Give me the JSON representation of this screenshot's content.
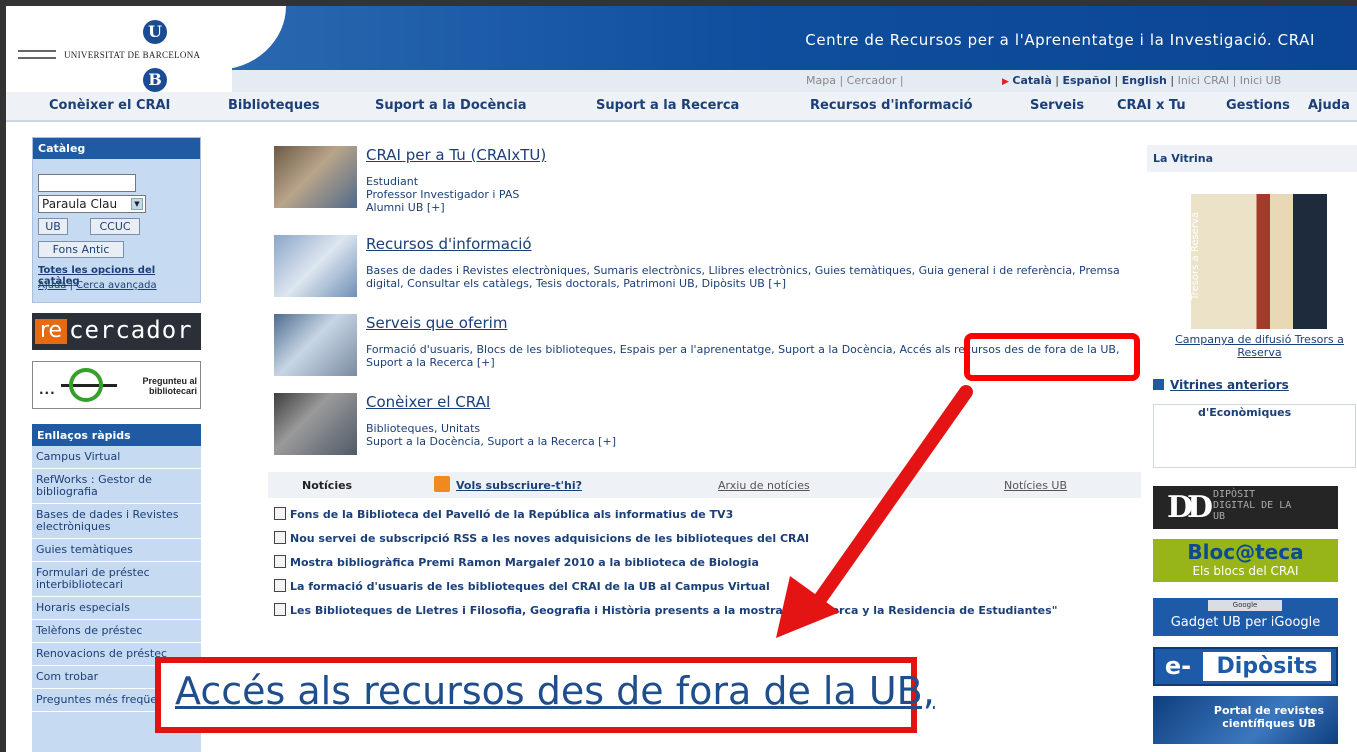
{
  "header": {
    "logo_top": "U",
    "logo_bottom": "B",
    "logo_text": "UNIVERSITAT DE BARCELONA",
    "title": "Centre de Recursos per a l'Aprenentatge i la Investigació. CRAI",
    "util_left": "Mapa | Cercador |",
    "util_langs": [
      "Català",
      "Español",
      "English"
    ],
    "util_right": "Inici CRAI | Inici UB"
  },
  "nav": {
    "items": [
      "Conèixer el CRAI",
      "Biblioteques",
      "Suport a la Docència",
      "Suport a la Recerca",
      "Recursos d'informació",
      "Serveis",
      "CRAI x Tu",
      "Gestions",
      "Ajuda"
    ]
  },
  "catalog": {
    "title": "Catàleg",
    "search_value": "",
    "select_value": "Paraula Clau",
    "btn_ub": "UB",
    "btn_ccuc": "CCUC",
    "btn_fons": "Fons Antic",
    "link_all": "Totes les opcions del catàleg",
    "link_help": "Ajuda",
    "link_adv": "Cerca avançada"
  },
  "recercador": {
    "prefix": "re",
    "text": "cercador"
  },
  "pregunteu": {
    "text": "Pregunteu al bibliotecari"
  },
  "quicklinks": {
    "title": "Enllaços ràpids",
    "items": [
      "Campus Virtual",
      "RefWorks : Gestor de bibliografia",
      "Bases de dades i Revistes electròniques",
      "Guies temàtiques",
      "Formulari de préstec interbibliotecari",
      "Horaris especials",
      "Telèfons de préstec",
      "Renovacions de préstec",
      "Com trobar",
      "Preguntes més freqüents"
    ]
  },
  "sections": [
    {
      "title": "CRAI per a Tu (CRAIxTU)",
      "body": "Estudiant\nProfessor Investigador i PAS\nAlumni UB [+]"
    },
    {
      "title": "Recursos d'informació",
      "body": "Bases de dades i Revistes electròniques, Sumaris electrònics, Llibres electrònics, Guies temàtiques, Guia general i de referència, Premsa digital, Consultar els catàlegs, Tesis doctorals, Patrimoni UB, Dipòsits UB [+]"
    },
    {
      "title": "Serveis que oferim",
      "body": "Formació d'usuaris, Blocs de les biblioteques, Espais per a l'aprenentatge, Suport a la Docència, Accés als recursos des de fora de la UB, Suport a la Recerca [+]"
    },
    {
      "title": "Conèixer el CRAI",
      "body": "Biblioteques, Unitats\nSuport a la Docència, Suport a la Recerca [+]"
    }
  ],
  "news": {
    "label": "Notícies",
    "subscribe": "Vols subscriure-t'hi?",
    "archive": "Arxiu de notícies",
    "ub_news": "Notícies UB",
    "items": [
      "Fons de la Biblioteca del Pavelló de la República als informatius de TV3",
      "Nou servei de subscripció RSS a les noves adquisicions de les biblioteques del CRAI",
      "Mostra bibliogràfica Premi Ramon Margalef 2010 a la biblioteca de Biologia",
      "La formació d'usuaris de les biblioteques del CRAI de la UB al Campus Virtual",
      "Les Biblioteques de Lletres i Filosofia, Geografia i Història presents a la mostra \"Dalí, Lorca y la Residencia de Estudiantes\""
    ]
  },
  "vitrina": {
    "title": "La Vitrina",
    "image_text": "Tresors a Reserva",
    "caption": "Campanya de difusió Tresors a Reserva",
    "previous": "Vitrines anteriors",
    "box_text": "d'Econòmiques"
  },
  "banners": {
    "dipo_logo": "DD",
    "dipo_text": "DIPÒSIT DIGITAL DE LA UB",
    "bloc_title": "Bloc@teca",
    "bloc_sub": "Els blocs del CRAI",
    "gadget_small": "Google",
    "gadget_text": "Gadget UB per iGoogle",
    "edip_e": "e-",
    "edip_text": "Dipòsits",
    "portal_text": "Portal de revistes científiques UB"
  },
  "annotation": {
    "zoom_text": "Accés als recursos des de fora de la UB,",
    "highlight_color": "#ff0000"
  }
}
